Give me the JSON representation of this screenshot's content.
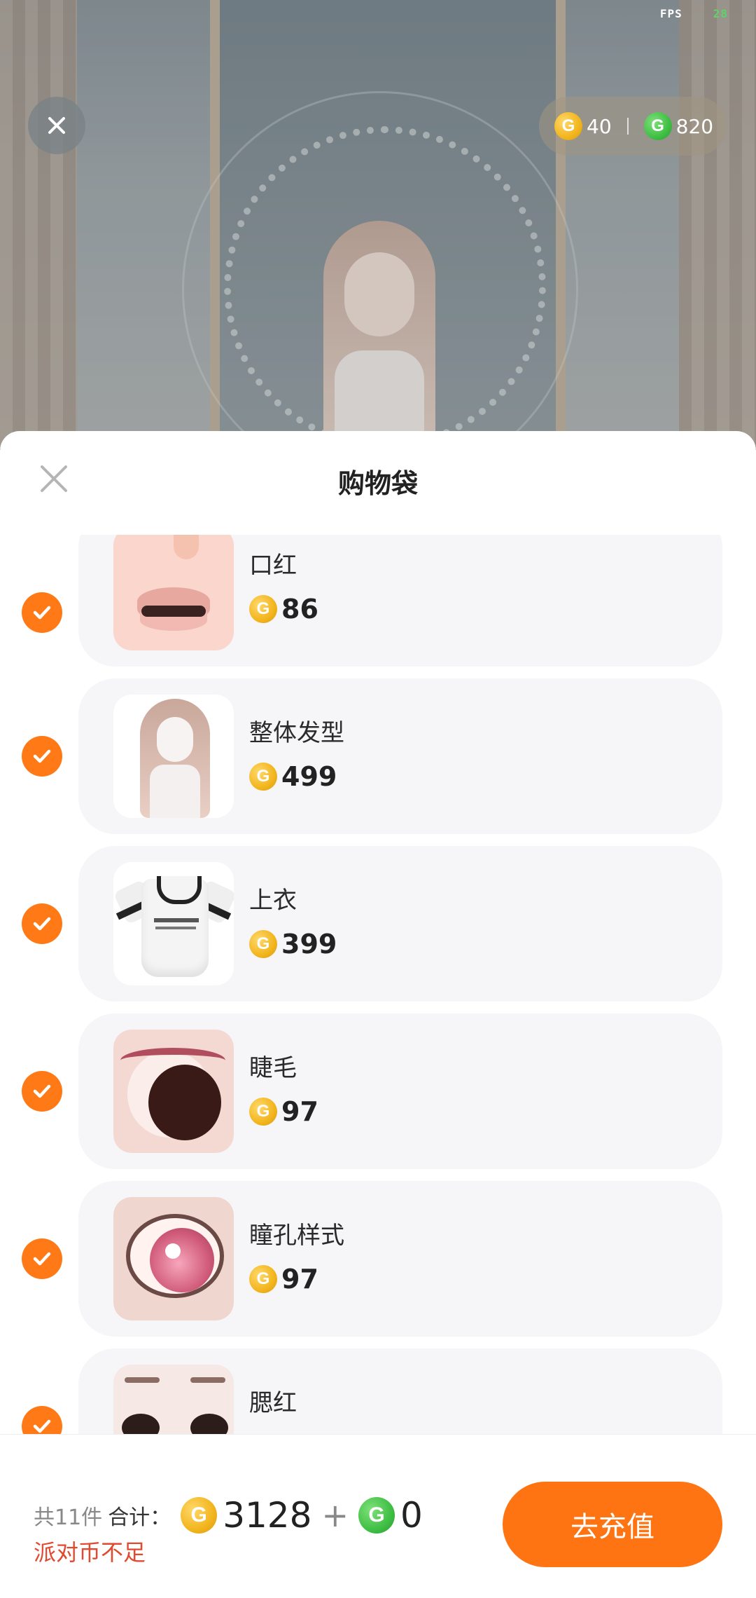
{
  "status": {
    "fps_label": "FPS",
    "fps_value": "28"
  },
  "top_bar": {
    "gold_amount": "40",
    "green_amount": "820"
  },
  "sheet": {
    "title": "购物袋",
    "items": [
      {
        "name": "口红",
        "price": "86",
        "checked": true,
        "thumb_icon": "lipstick-thumbnail"
      },
      {
        "name": "整体发型",
        "price": "499",
        "checked": true,
        "thumb_icon": "hairstyle-thumbnail"
      },
      {
        "name": "上衣",
        "price": "399",
        "checked": true,
        "thumb_icon": "top-shirt-thumbnail"
      },
      {
        "name": "睫毛",
        "price": "97",
        "checked": true,
        "thumb_icon": "eyelash-thumbnail"
      },
      {
        "name": "瞳孔样式",
        "price": "97",
        "checked": true,
        "thumb_icon": "pupil-style-thumbnail"
      },
      {
        "name": "腮红",
        "price": "",
        "checked": true,
        "thumb_icon": "blush-thumbnail"
      }
    ]
  },
  "footer": {
    "count_text": "共11件",
    "total_label": "合计：",
    "total_gold": "3128",
    "plus": "+",
    "total_green": "0",
    "warning": "派对币不足",
    "recharge_button": "去充值"
  },
  "colors": {
    "accent_orange": "#ff7412",
    "warning_red": "#e04a2f",
    "gold_coin": "#f2b51d",
    "green_coin": "#3fbf44",
    "card_bg": "#f6f5f8"
  },
  "coin_letter": "G"
}
